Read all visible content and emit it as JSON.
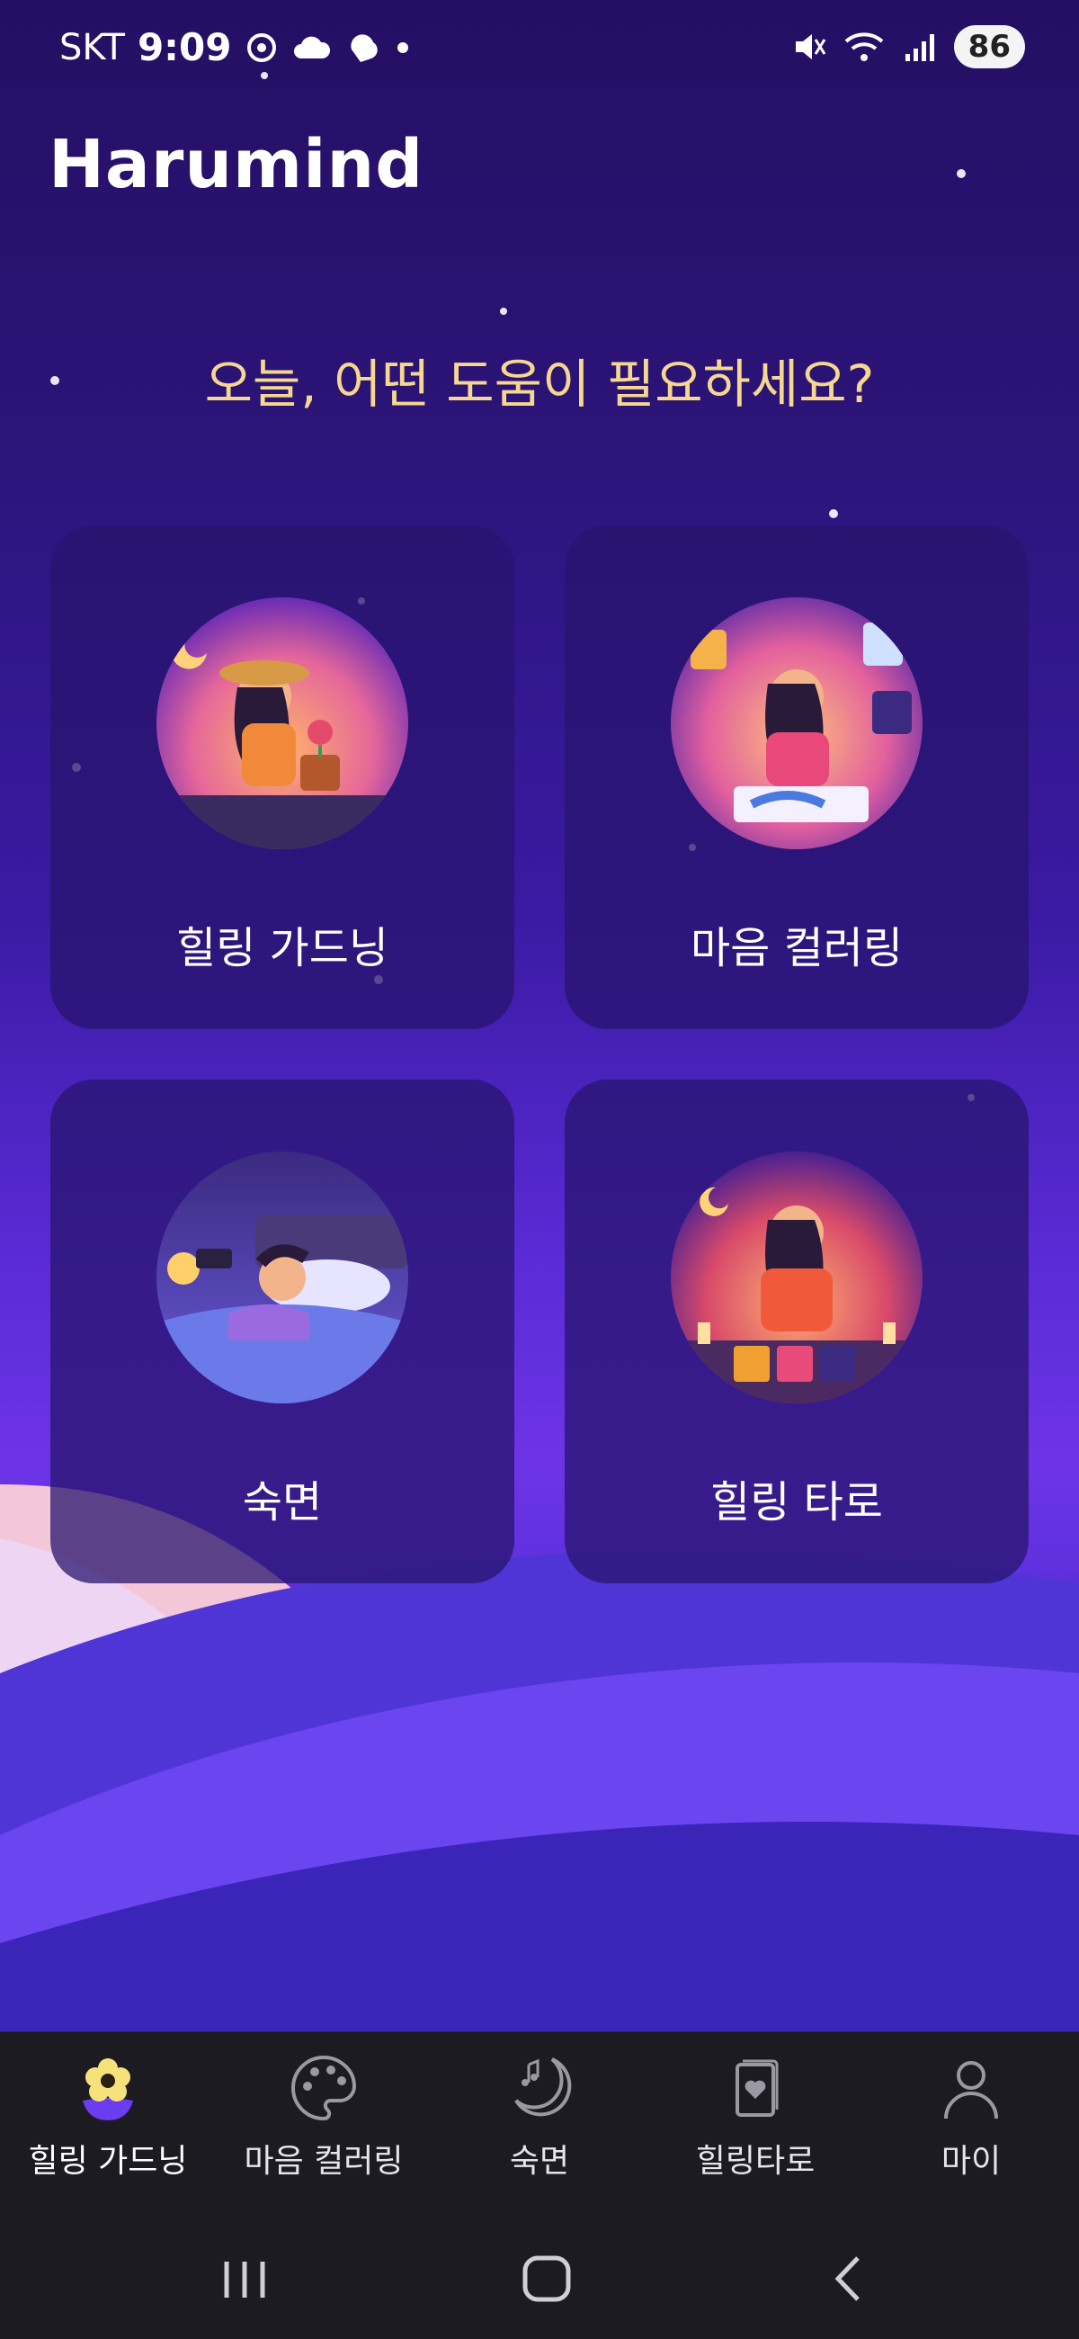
{
  "status_bar": {
    "carrier": "SKT",
    "time": "9:09",
    "battery": "86"
  },
  "app": {
    "title": "Harumind",
    "headline": "오늘, 어떤 도움이 필요하세요?"
  },
  "cards": [
    {
      "label": "힐링 가드닝",
      "icon": "gardening-illustration"
    },
    {
      "label": "마음 컬러링",
      "icon": "coloring-illustration"
    },
    {
      "label": "숙면",
      "icon": "sleep-illustration"
    },
    {
      "label": "힐링 타로",
      "icon": "tarot-illustration"
    }
  ],
  "bottom_nav": [
    {
      "label": "힐링 가드닝",
      "icon": "flower-icon",
      "active": true
    },
    {
      "label": "마음 컬러링",
      "icon": "palette-icon",
      "active": false
    },
    {
      "label": "숙면",
      "icon": "moon-music-icon",
      "active": false
    },
    {
      "label": "힐링타로",
      "icon": "tarot-card-icon",
      "active": false
    },
    {
      "label": "마이",
      "icon": "person-icon",
      "active": false
    }
  ],
  "colors": {
    "headline": "#f5d78f",
    "accent": "#6b3cf0",
    "active_icon": "#f6e27a"
  }
}
